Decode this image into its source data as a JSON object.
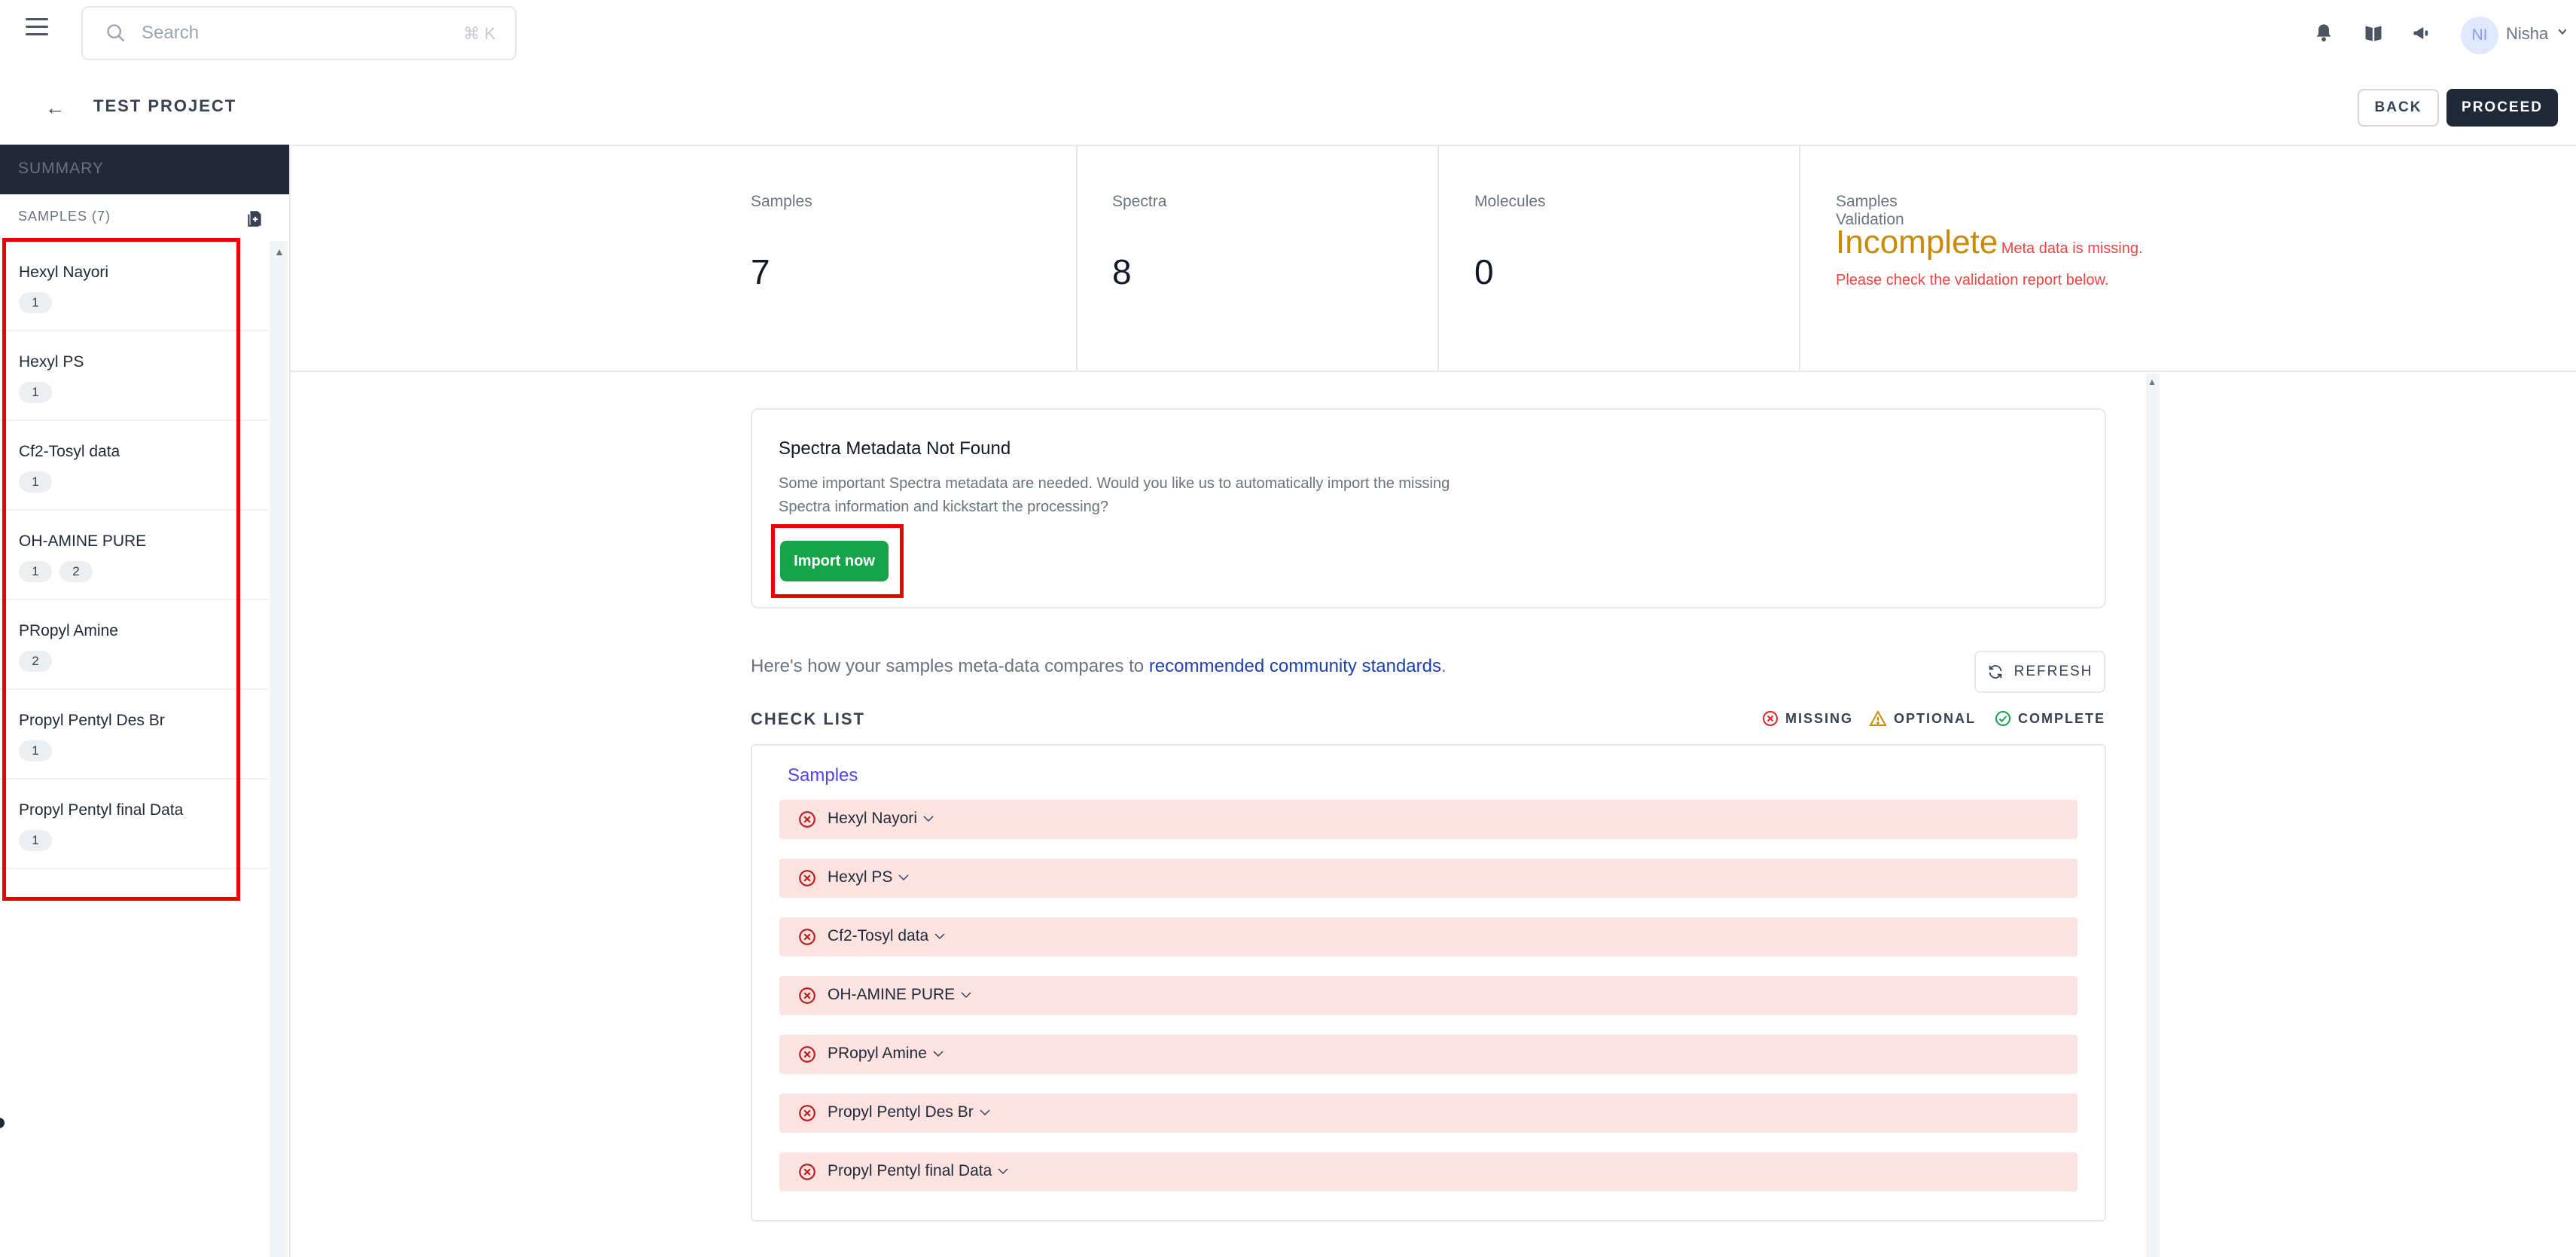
{
  "topbar": {
    "search_placeholder": "Search",
    "search_shortcut": "⌘ K",
    "user_initials": "NI",
    "user_name": "Nisha"
  },
  "project": {
    "title": "TEST PROJECT",
    "back_label": "BACK",
    "proceed_label": "PROCEED"
  },
  "sidebar": {
    "summary_label": "SUMMARY",
    "samples_header": "SAMPLES (7)",
    "items": [
      {
        "name": "Hexyl Nayori",
        "badges": [
          "1"
        ]
      },
      {
        "name": "Hexyl PS",
        "badges": [
          "1"
        ]
      },
      {
        "name": "Cf2-Tosyl data",
        "badges": [
          "1"
        ]
      },
      {
        "name": "OH-AMINE PURE",
        "badges": [
          "1",
          "2"
        ]
      },
      {
        "name": "PRopyl Amine",
        "badges": [
          "2"
        ]
      },
      {
        "name": "Propyl Pentyl Des Br",
        "badges": [
          "1"
        ]
      },
      {
        "name": "Propyl Pentyl final Data",
        "badges": [
          "1"
        ]
      }
    ]
  },
  "stats": {
    "samples_label": "Samples",
    "samples_value": "7",
    "spectra_label": "Spectra",
    "spectra_value": "8",
    "molecules_label": "Molecules",
    "molecules_value": "0",
    "validation_label": "Samples Validation",
    "validation_status": "Incomplete",
    "validation_note": "Meta data is missing. Please check the validation report below."
  },
  "metadata_card": {
    "title": "Spectra Metadata Not Found",
    "description": "Some important Spectra metadata are needed. Would you like us to automatically import the missing Spectra information and kickstart the processing?",
    "import_label": "Import now"
  },
  "standards": {
    "prefix": "Here's how your samples meta-data compares to ",
    "link": "recommended community standards",
    "suffix": ".",
    "refresh_label": "REFRESH"
  },
  "checklist": {
    "title": "CHECK LIST",
    "legend_missing": "MISSING",
    "legend_optional": "OPTIONAL",
    "legend_complete": "COMPLETE",
    "section_title": "Samples",
    "rows": [
      "Hexyl Nayori",
      "Hexyl PS",
      "Cf2-Tosyl data",
      "OH-AMINE PURE",
      "PRopyl Amine",
      "Propyl Pentyl Des Br",
      "Propyl Pentyl final Data"
    ]
  },
  "colors": {
    "accent_dark": "#1f2937",
    "import_green": "#16a34a",
    "incomplete": "#ca8a04",
    "error_red": "#ef4444",
    "missing_row_bg": "#fde2e2",
    "annotation_red": "#ef0000"
  }
}
